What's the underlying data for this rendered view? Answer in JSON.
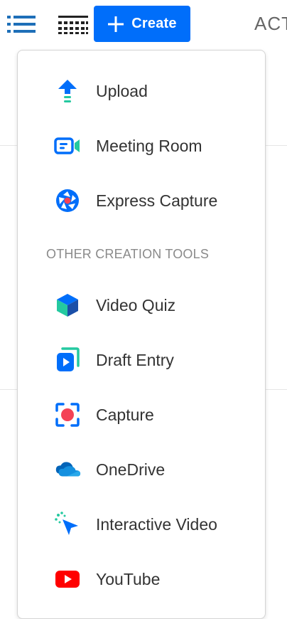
{
  "toolbar": {
    "list_view_icon": "list-icon",
    "grid_view_icon": "grid-icon",
    "create_label": "Create",
    "cut_text": "ACT"
  },
  "menu": {
    "primary_items": [
      {
        "label": "Upload",
        "icon": "upload-arrow-icon"
      },
      {
        "label": "Meeting Room",
        "icon": "meeting-room-icon"
      },
      {
        "label": "Express Capture",
        "icon": "express-capture-icon"
      }
    ],
    "section_header": "OTHER CREATION TOOLS",
    "other_items": [
      {
        "label": "Video Quiz",
        "icon": "video-quiz-cube-icon"
      },
      {
        "label": "Draft Entry",
        "icon": "draft-entry-icon"
      },
      {
        "label": "Capture",
        "icon": "capture-record-icon"
      },
      {
        "label": "OneDrive",
        "icon": "onedrive-cloud-icon"
      },
      {
        "label": "Interactive Video",
        "icon": "interactive-video-cursor-icon"
      },
      {
        "label": "YouTube",
        "icon": "youtube-icon"
      }
    ]
  },
  "colors": {
    "primary_blue": "#006efa",
    "youtube_red": "#ff0000",
    "capture_red": "#f44256",
    "teal": "#24c9a0"
  }
}
